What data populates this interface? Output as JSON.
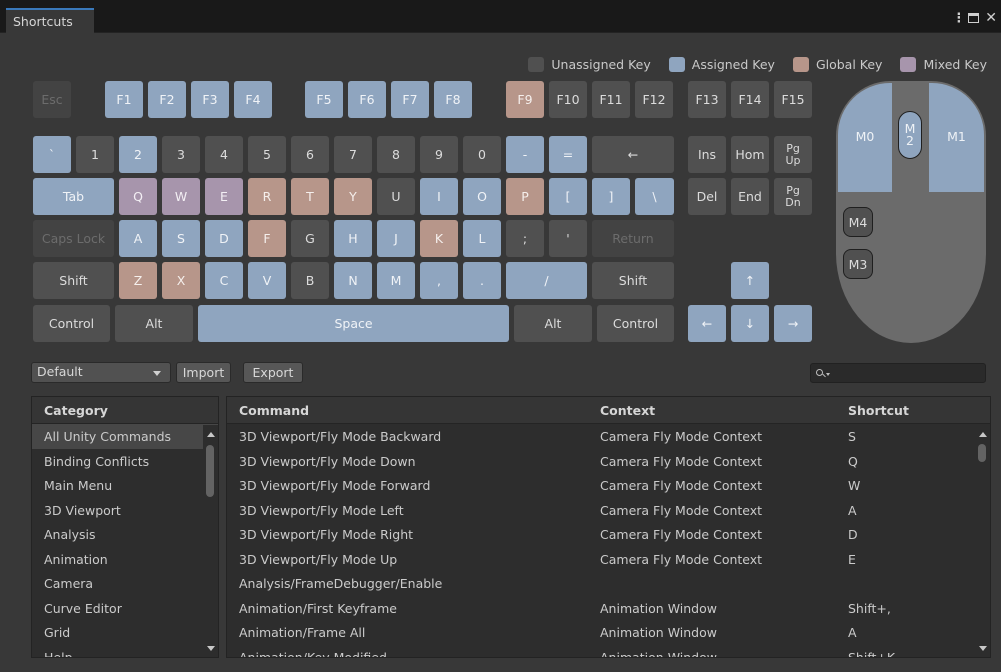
{
  "window": {
    "tab_title": "Shortcuts",
    "menu_icon": "kebab-menu-icon",
    "maximize_icon": "maximize-icon",
    "close_icon": "close-icon"
  },
  "colors": {
    "unassigned": "#505050",
    "assigned": "#8fa5bf",
    "global": "#b7968a",
    "mixed": "#a795ac"
  },
  "legend": {
    "unassigned": "Unassigned Key",
    "assigned": "Assigned Key",
    "global": "Global Key",
    "mixed": "Mixed Key"
  },
  "keys": {
    "esc": "Esc",
    "f1": "F1",
    "f2": "F2",
    "f3": "F3",
    "f4": "F4",
    "f5": "F5",
    "f6": "F6",
    "f7": "F7",
    "f8": "F8",
    "f9": "F9",
    "f10": "F10",
    "f11": "F11",
    "f12": "F12",
    "f13": "F13",
    "f14": "F14",
    "f15": "F15",
    "backquote": "`",
    "d1": "1",
    "d2": "2",
    "d3": "3",
    "d4": "4",
    "d5": "5",
    "d6": "6",
    "d7": "7",
    "d8": "8",
    "d9": "9",
    "d0": "0",
    "minus": "-",
    "equals": "=",
    "backspace": "←",
    "tab": "Tab",
    "q": "Q",
    "w": "W",
    "e": "E",
    "r": "R",
    "t": "T",
    "y": "Y",
    "u": "U",
    "i": "I",
    "o": "O",
    "p": "P",
    "lbracket": "[",
    "rbracket": "]",
    "backslash": "\\",
    "capslock": "Caps Lock",
    "a": "A",
    "s": "S",
    "d": "D",
    "f": "F",
    "g": "G",
    "h": "H",
    "j": "J",
    "k": "K",
    "l": "L",
    "semicolon": ";",
    "quote": "'",
    "return": "Return",
    "lshift": "Shift",
    "z": "Z",
    "x": "X",
    "c": "C",
    "v": "V",
    "b": "B",
    "n": "N",
    "m": "M",
    "comma": ",",
    "period": ".",
    "slash": "/",
    "rshift": "Shift",
    "lcontrol": "Control",
    "lalt": "Alt",
    "space": "Space",
    "ralt": "Alt",
    "rcontrol": "Control",
    "ins": "Ins",
    "home": "Hom",
    "pgup_1": "Pg",
    "pgup_2": "Up",
    "del": "Del",
    "end": "End",
    "pgdn_1": "Pg",
    "pgdn_2": "Dn",
    "up": "↑",
    "left": "←",
    "down": "↓",
    "right": "→"
  },
  "mouse": {
    "m0": "M0",
    "m1": "M1",
    "m2_1": "M",
    "m2_2": "2",
    "m3": "M3",
    "m4": "M4"
  },
  "toolbar": {
    "profile": "Default",
    "import": "Import",
    "export": "Export"
  },
  "category": {
    "header": "Category",
    "items": [
      "All Unity Commands",
      "Binding Conflicts",
      "Main Menu",
      "3D Viewport",
      "Analysis",
      "Animation",
      "Camera",
      "Curve Editor",
      "Grid",
      "Help"
    ],
    "selected": "All Unity Commands"
  },
  "commands": {
    "headers": {
      "command": "Command",
      "context": "Context",
      "shortcut": "Shortcut"
    },
    "rows": [
      {
        "command": "3D Viewport/Fly Mode Backward",
        "context": "Camera Fly Mode Context",
        "shortcut": "S"
      },
      {
        "command": "3D Viewport/Fly Mode Down",
        "context": "Camera Fly Mode Context",
        "shortcut": "Q"
      },
      {
        "command": "3D Viewport/Fly Mode Forward",
        "context": "Camera Fly Mode Context",
        "shortcut": "W"
      },
      {
        "command": "3D Viewport/Fly Mode Left",
        "context": "Camera Fly Mode Context",
        "shortcut": "A"
      },
      {
        "command": "3D Viewport/Fly Mode Right",
        "context": "Camera Fly Mode Context",
        "shortcut": "D"
      },
      {
        "command": "3D Viewport/Fly Mode Up",
        "context": "Camera Fly Mode Context",
        "shortcut": "E"
      },
      {
        "command": "Analysis/FrameDebugger/Enable",
        "context": "",
        "shortcut": ""
      },
      {
        "command": "Animation/First Keyframe",
        "context": "Animation Window",
        "shortcut": "Shift+,"
      },
      {
        "command": "Animation/Frame All",
        "context": "Animation Window",
        "shortcut": "A"
      },
      {
        "command": "Animation/Key Modified",
        "context": "Animation Window",
        "shortcut": "Shift+K"
      }
    ]
  }
}
